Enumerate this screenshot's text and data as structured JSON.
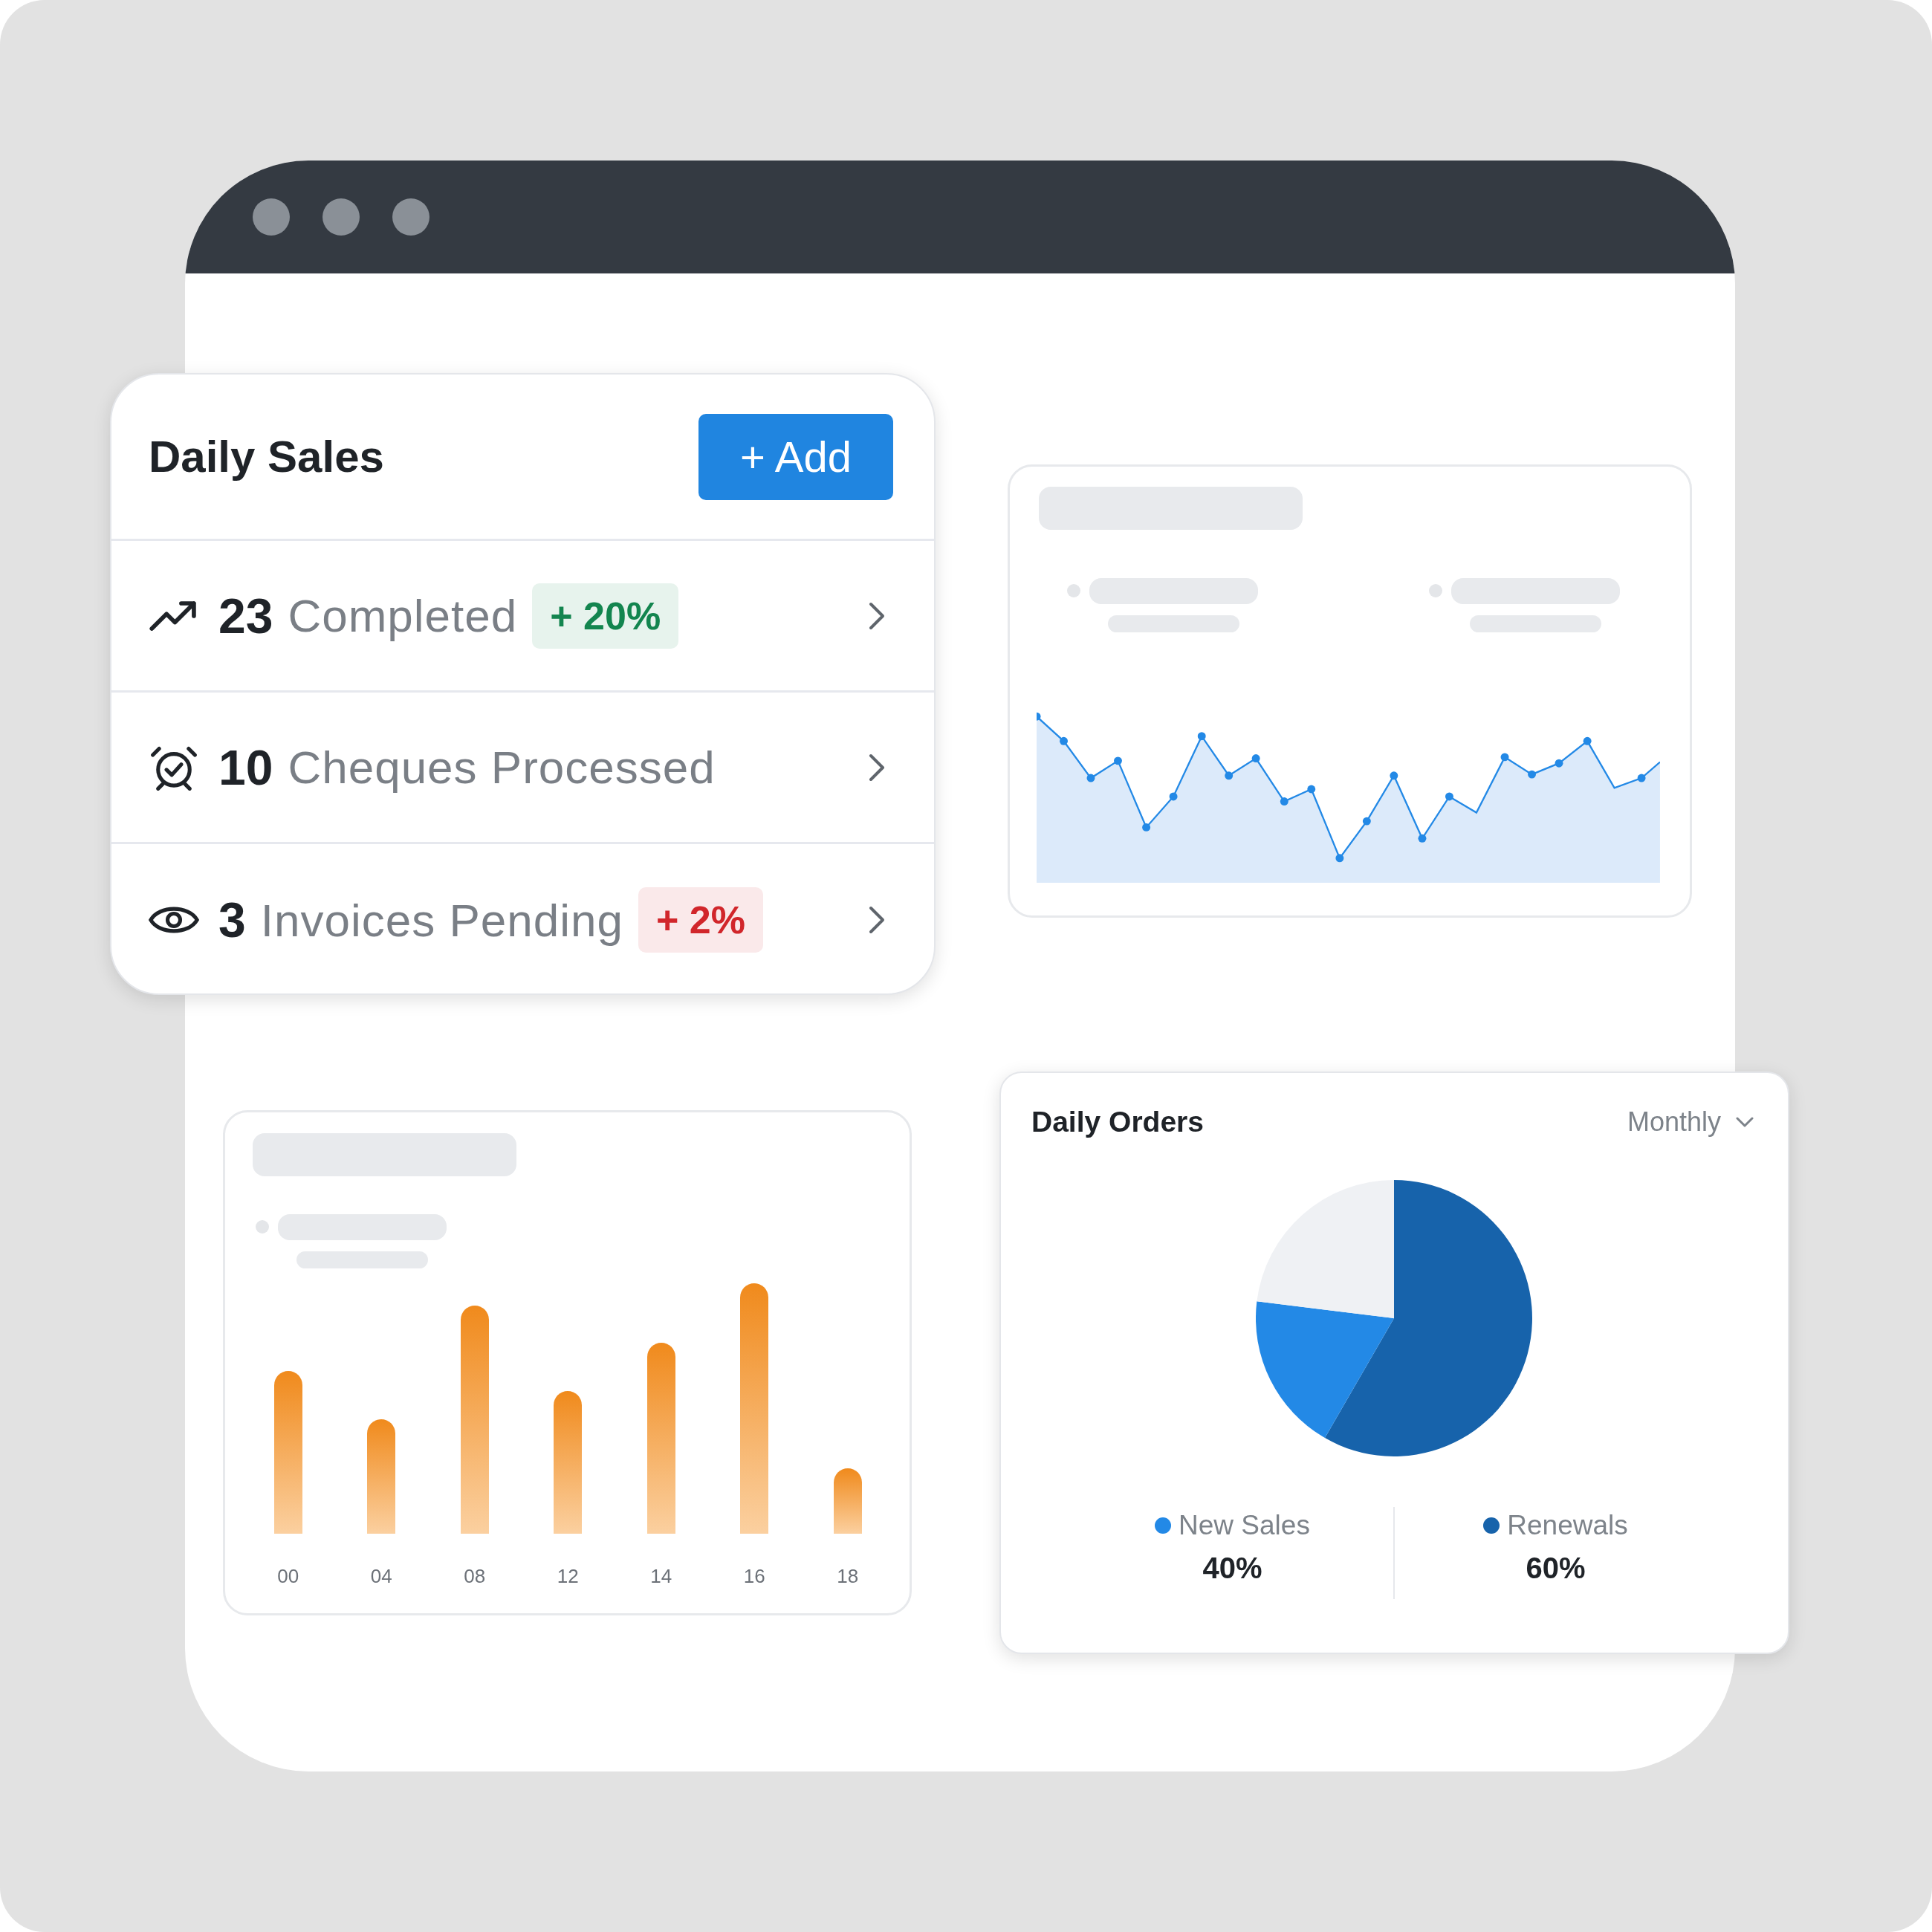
{
  "daily_sales": {
    "title": "Daily Sales",
    "add_button": "+ Add",
    "rows": [
      {
        "kind": "trend",
        "count": "23",
        "label": "Completed",
        "badge": {
          "text": "+ 20%",
          "color": "#13854f"
        }
      },
      {
        "kind": "alarm",
        "count": "10",
        "label": "Cheques Processed"
      },
      {
        "kind": "eye",
        "count": "3",
        "label": "Invoices Pending",
        "badge": {
          "text": "+ 2%",
          "color": "#d1262b"
        }
      }
    ]
  },
  "bar_panel": {
    "x_labels": [
      "00",
      "04",
      "08",
      "12",
      "14",
      "16",
      "18"
    ]
  },
  "daily_orders": {
    "title": "Daily Orders",
    "period": "Monthly",
    "legend": [
      {
        "label": "New Sales",
        "value": "40%",
        "color": "#2389e6"
      },
      {
        "label": "Renewals",
        "value": "60%",
        "color": "#1763ab"
      }
    ]
  }
}
